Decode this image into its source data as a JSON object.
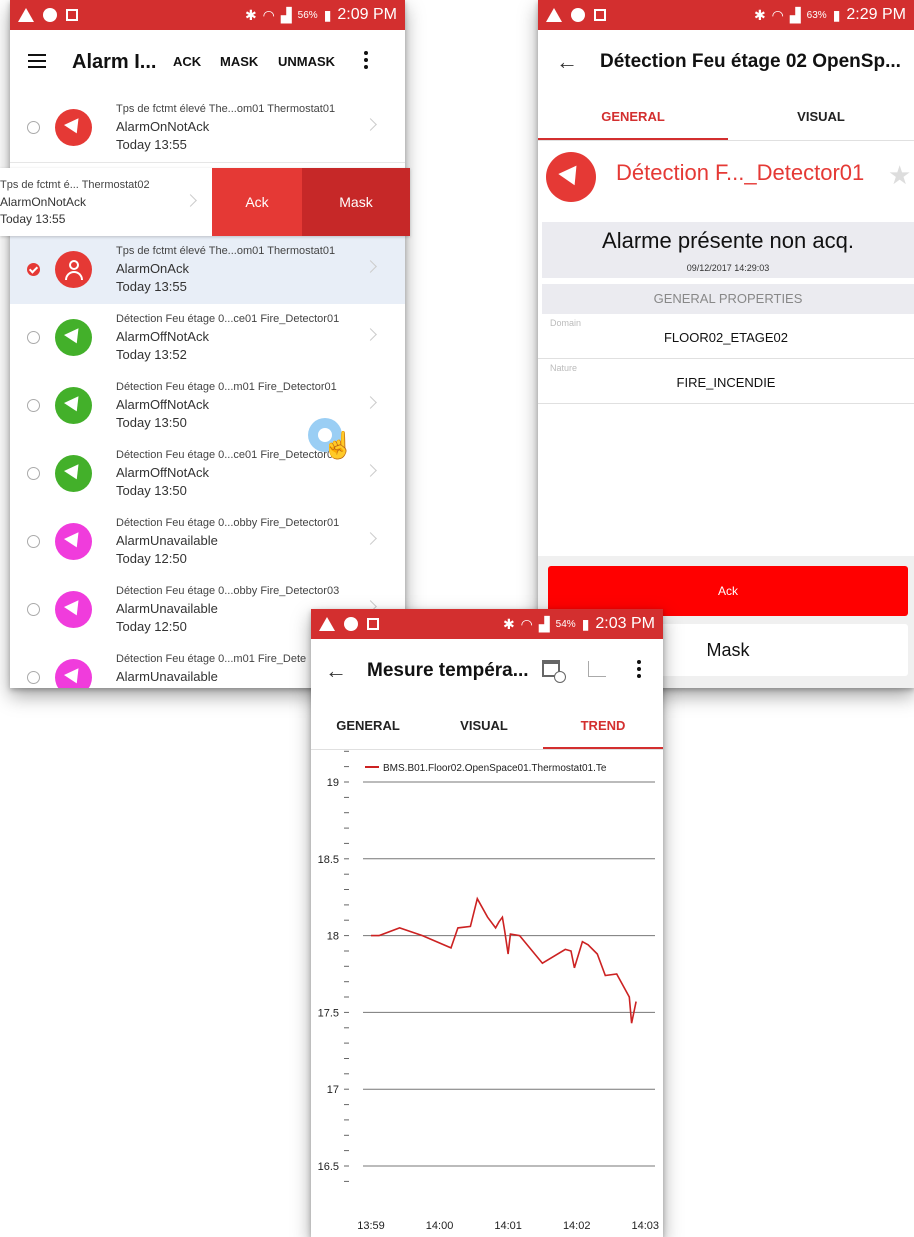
{
  "screens": {
    "list": {
      "status": {
        "battery": "56%",
        "time": "2:09 PM"
      },
      "title": "Alarm I...",
      "actions": {
        "ack": "ACK",
        "mask": "MASK",
        "unmask": "UNMASK"
      },
      "rows": [
        {
          "title": "Tps de fctmt élevé The...om01 Thermostat01",
          "status": "AlarmOnNotAck",
          "time": "Today 13:55",
          "color": "#e53935",
          "icon": "alarm-icon"
        },
        {
          "title": "Tps de fctmt élevé The...om01 Thermostat01",
          "status": "AlarmOnAck",
          "time": "Today 13:55",
          "color": "#e53935",
          "icon": "user-icon"
        },
        {
          "title": "Détection Feu étage 0...ce01 Fire_Detector01",
          "status": "AlarmOffNotAck",
          "time": "Today 13:52",
          "color": "#43b02a",
          "icon": "alarm-icon"
        },
        {
          "title": "Détection Feu étage 0...m01 Fire_Detector01",
          "status": "AlarmOffNotAck",
          "time": "Today 13:50",
          "color": "#43b02a",
          "icon": "alarm-icon"
        },
        {
          "title": "Détection Feu étage 0...ce01 Fire_Detector01",
          "status": "AlarmOffNotAck",
          "time": "Today 13:50",
          "color": "#43b02a",
          "icon": "alarm-icon"
        },
        {
          "title": "Détection Feu étage 0...obby Fire_Detector01",
          "status": "AlarmUnavailable",
          "time": "Today 12:50",
          "color": "#f03cdc",
          "icon": "alarm-icon"
        },
        {
          "title": "Détection Feu étage 0...obby Fire_Detector03",
          "status": "AlarmUnavailable",
          "time": "Today 12:50",
          "color": "#f03cdc",
          "icon": "alarm-icon"
        },
        {
          "title": "Détection Feu étage 0...m01 Fire_Dete",
          "status": "AlarmUnavailable",
          "time": "",
          "color": "#f03cdc",
          "icon": "alarm-icon"
        }
      ],
      "swiped_row": {
        "title": "Tps de fctmt é... Thermostat02",
        "status": "AlarmOnNotAck",
        "time": "Today 13:55",
        "ack": "Ack",
        "mask": "Mask"
      }
    },
    "detail": {
      "status": {
        "battery": "63%",
        "time": "2:29 PM"
      },
      "title": "Détection Feu étage 02 OpenSp...",
      "tabs": {
        "general": "GENERAL",
        "visual": "VISUAL"
      },
      "name": "Détection F..._Detector01",
      "state": "Alarme présente non acq.",
      "date": "09/12/2017 14:29:03",
      "section": "GENERAL PROPERTIES",
      "properties": [
        {
          "key": "Domain",
          "value": "FLOOR02_ETAGE02"
        },
        {
          "key": "Nature",
          "value": "FIRE_INCENDIE"
        }
      ],
      "ack": "Ack",
      "mask": "Mask"
    },
    "trend": {
      "status": {
        "battery": "54%",
        "time": "2:03 PM"
      },
      "title": "Mesure tempéra...",
      "tabs": {
        "general": "GENERAL",
        "visual": "VISUAL",
        "trend": "TREND"
      }
    }
  },
  "chart_data": {
    "type": "line",
    "series": [
      {
        "name": "BMS.B01.Floor02.OpenSpace01.Thermostat01.Te",
        "color": "#cc2222",
        "x": [
          "13:59:00",
          "13:59:07",
          "13:59:25",
          "13:59:45",
          "14:00:10",
          "14:00:16",
          "14:00:27",
          "14:00:33",
          "14:00:42",
          "14:00:49",
          "14:00:52",
          "14:00:55",
          "14:00:57",
          "14:01:00",
          "14:01:02",
          "14:01:10",
          "14:01:30",
          "14:01:50",
          "14:01:55",
          "14:01:58",
          "14:02:05",
          "14:02:10",
          "14:02:18",
          "14:02:25",
          "14:02:35",
          "14:02:46",
          "14:02:48",
          "14:02:52"
        ],
        "y": [
          18.0,
          18.0,
          18.05,
          18.0,
          17.92,
          18.05,
          18.06,
          18.24,
          18.12,
          18.05,
          18.09,
          18.12,
          18.03,
          17.88,
          18.01,
          18.0,
          17.82,
          17.91,
          17.9,
          17.79,
          17.96,
          17.94,
          17.88,
          17.74,
          17.75,
          17.6,
          17.43,
          17.57
        ]
      }
    ],
    "xticks": [
      "13:59",
      "14:00",
      "14:01",
      "14:02",
      "14:03"
    ],
    "yticks": [
      "19",
      "18.5",
      "18",
      "17.5",
      "17",
      "16.5"
    ],
    "xlim": [
      "13:58:53",
      "14:03:05"
    ],
    "ylim": [
      16.1,
      19.25
    ],
    "grid": true,
    "legend": "top"
  }
}
